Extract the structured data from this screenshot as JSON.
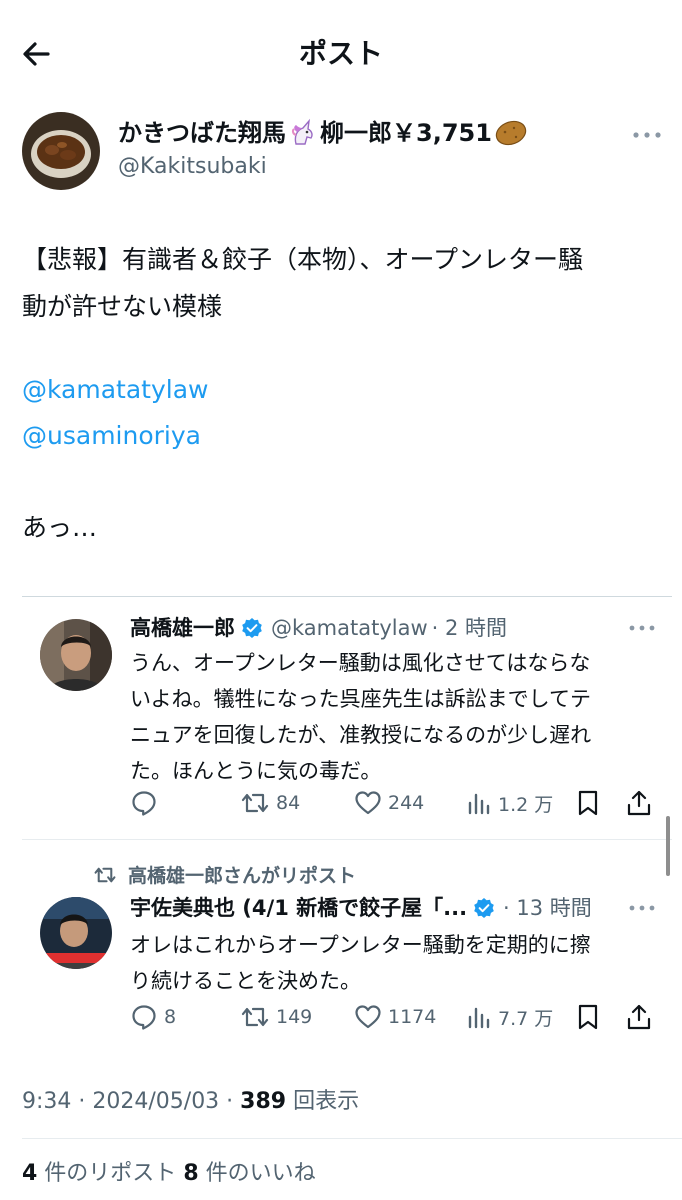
{
  "header": {
    "title": "ポスト"
  },
  "author": {
    "name": "かきつばた翔馬",
    "name_suffix": "柳一郎￥3,751",
    "handle": "@Kakitsubaki"
  },
  "post": {
    "line1": "【悲報】有識者＆餃子（本物）、オープンレター騒",
    "line2": "動が許せない模様",
    "mention1": "@kamatatylaw",
    "mention2": "@usaminoriya",
    "closing": "あっ…"
  },
  "quotes": [
    {
      "name": "高橋雄一郎",
      "handle": "@kamatatylaw",
      "time": "· 2 時間",
      "lines": [
        "うん、オープンレター騒動は風化させてはならな",
        "いよね。犠牲になった呉座先生は訴訟までしてテ",
        "ニュアを回復したが、准教授になるのが少し遅れ",
        "た。ほんとうに気の毒だ。"
      ],
      "reply_count": "",
      "repost_count": "84",
      "like_count": "244",
      "view_count": "1.2 万"
    },
    {
      "repost_label": "高橋雄一郎さんがリポスト",
      "name": "宇佐美典也 (4/1 新橋で餃子屋「...",
      "time": "· 13 時間",
      "lines": [
        "オレはこれからオープンレター騒動を定期的に擦",
        "り続けることを決めた。"
      ],
      "reply_count": "8",
      "repost_count": "149",
      "like_count": "1174",
      "view_count": "7.7 万"
    }
  ],
  "footer": {
    "timestamp": "9:34 · 2024/05/03 · ",
    "view_count": "389",
    "view_label": " 回表示",
    "repost_count": "4",
    "repost_label": " 件のリポスト ",
    "like_count": "8",
    "like_label": " 件のいいね"
  },
  "colors": {
    "accent": "#1d9bf0",
    "muted": "#536471",
    "text": "#0f1419"
  },
  "icons": [
    "back-arrow-icon",
    "unicorn-icon",
    "potato-icon",
    "more-icon",
    "verified-icon",
    "reply-icon",
    "repost-icon",
    "like-icon",
    "views-icon",
    "bookmark-icon",
    "share-icon"
  ]
}
